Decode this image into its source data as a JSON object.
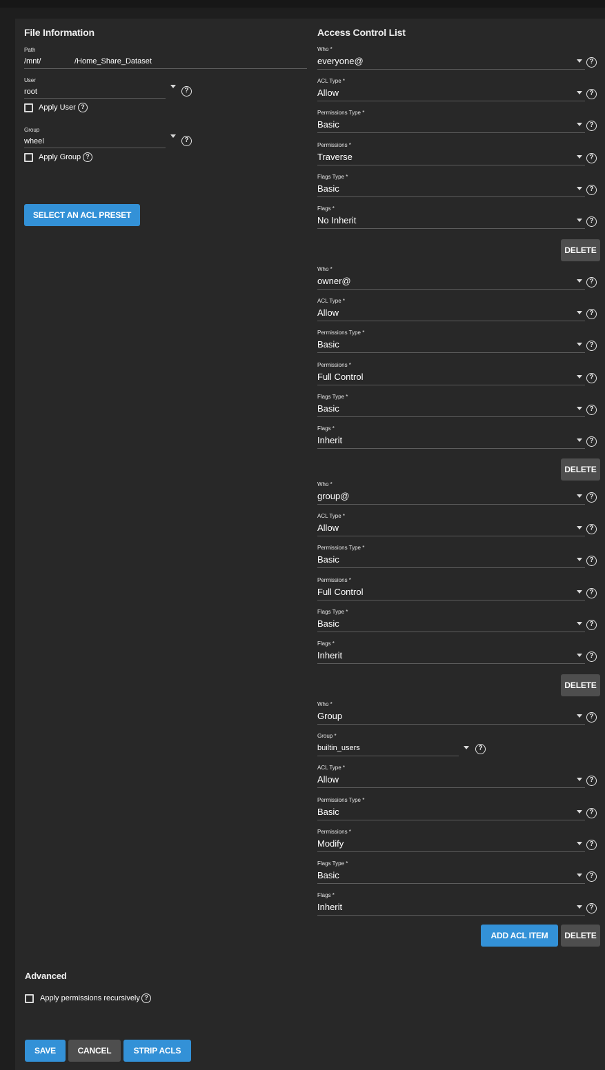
{
  "file_info": {
    "title": "File Information",
    "path_label": "Path",
    "path_prefix": "/mnt/",
    "path_suffix": "/Home_Share_Dataset",
    "user_label": "User",
    "user_value": "root",
    "apply_user_label": "Apply User",
    "group_label": "Group",
    "group_value": "wheel",
    "apply_group_label": "Apply Group",
    "preset_button": "SELECT AN ACL PRESET"
  },
  "acl": {
    "title": "Access Control List",
    "labels": {
      "who": "Who *",
      "acl_type": "ACL Type *",
      "perm_type": "Permissions Type *",
      "perms": "Permissions *",
      "flags_type": "Flags Type *",
      "flags": "Flags *",
      "group": "Group *"
    },
    "items": [
      {
        "who": "everyone@",
        "acl_type": "Allow",
        "perm_type": "Basic",
        "perms": "Traverse",
        "flags_type": "Basic",
        "flags": "No Inherit"
      },
      {
        "who": "owner@",
        "acl_type": "Allow",
        "perm_type": "Basic",
        "perms": "Full Control",
        "flags_type": "Basic",
        "flags": "Inherit"
      },
      {
        "who": "group@",
        "acl_type": "Allow",
        "perm_type": "Basic",
        "perms": "Full Control",
        "flags_type": "Basic",
        "flags": "Inherit"
      },
      {
        "who": "Group",
        "group": "builtin_users",
        "acl_type": "Allow",
        "perm_type": "Basic",
        "perms": "Modify",
        "flags_type": "Basic",
        "flags": "Inherit"
      }
    ],
    "delete_label": "DELETE",
    "add_label": "ADD ACL ITEM"
  },
  "advanced": {
    "title": "Advanced",
    "recursive_label": "Apply permissions recursively"
  },
  "footer": {
    "save": "SAVE",
    "cancel": "CANCEL",
    "strip": "STRIP ACLS"
  },
  "colors": {
    "primary": "#3391d7",
    "grey_button": "#4e4e4e",
    "card": "#282828",
    "background": "#1e1e1e"
  }
}
